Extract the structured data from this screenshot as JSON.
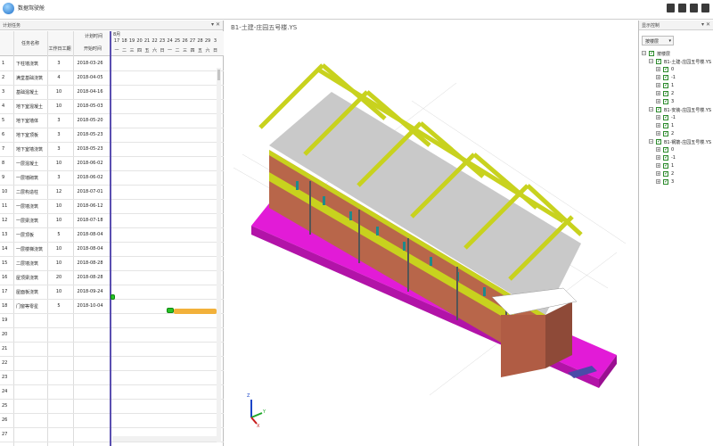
{
  "app": {
    "title": "数据驾驶舱"
  },
  "left_pane": {
    "title": "计划任务",
    "headers": {
      "task_name": "任务名称",
      "plan_time": "计划时间",
      "work_days": "工作日工期",
      "start_time": "开始时间",
      "month": "8月",
      "days": [
        "17",
        "18",
        "19",
        "20",
        "21",
        "22",
        "23",
        "24",
        "25",
        "26",
        "27",
        "28",
        "29",
        "3"
      ],
      "weekdays": [
        "一",
        "二",
        "三",
        "四",
        "五",
        "六",
        "日",
        "一",
        "二",
        "三",
        "四",
        "五",
        "六",
        "日"
      ]
    },
    "rows": [
      {
        "idx": "1",
        "name": "下柱墙浇筑",
        "dur": "3",
        "date": "2018-03-26"
      },
      {
        "idx": "2",
        "name": "满堂基础浇筑",
        "dur": "4",
        "date": "2018-04-05"
      },
      {
        "idx": "3",
        "name": "基础混凝土",
        "dur": "10",
        "date": "2018-04-16"
      },
      {
        "idx": "4",
        "name": "地下室混凝土",
        "dur": "10",
        "date": "2018-05-03"
      },
      {
        "idx": "5",
        "name": "地下室墙体",
        "dur": "3",
        "date": "2018-05-20"
      },
      {
        "idx": "6",
        "name": "地下室顶板",
        "dur": "3",
        "date": "2018-05-23"
      },
      {
        "idx": "7",
        "name": "地下室墙浇筑",
        "dur": "3",
        "date": "2018-05-23"
      },
      {
        "idx": "8",
        "name": "一层混凝土",
        "dur": "10",
        "date": "2018-06-02"
      },
      {
        "idx": "9",
        "name": "一层墙砌筑",
        "dur": "3",
        "date": "2018-06-02"
      },
      {
        "idx": "10",
        "name": "二层构造柱",
        "dur": "12",
        "date": "2018-07-01"
      },
      {
        "idx": "11",
        "name": "一层墙浇筑",
        "dur": "10",
        "date": "2018-06-12"
      },
      {
        "idx": "12",
        "name": "一层梁浇筑",
        "dur": "10",
        "date": "2018-07-18"
      },
      {
        "idx": "13",
        "name": "一层顶板",
        "dur": "5",
        "date": "2018-08-04"
      },
      {
        "idx": "14",
        "name": "一层楼梯浇筑",
        "dur": "10",
        "date": "2018-08-04"
      },
      {
        "idx": "15",
        "name": "二层墙浇筑",
        "dur": "10",
        "date": "2018-08-28"
      },
      {
        "idx": "16",
        "name": "屋顶梁浇筑",
        "dur": "20",
        "date": "2018-08-28"
      },
      {
        "idx": "17",
        "name": "屋面板浇筑",
        "dur": "10",
        "date": "2018-09-24"
      },
      {
        "idx": "18",
        "name": "门窗等零星",
        "dur": "5",
        "date": "2018-10-04"
      },
      {
        "idx": "19",
        "name": "",
        "dur": "",
        "date": ""
      },
      {
        "idx": "20",
        "name": "",
        "dur": "",
        "date": ""
      },
      {
        "idx": "21",
        "name": "",
        "dur": "",
        "date": ""
      },
      {
        "idx": "22",
        "name": "",
        "dur": "",
        "date": ""
      },
      {
        "idx": "23",
        "name": "",
        "dur": "",
        "date": ""
      },
      {
        "idx": "24",
        "name": "",
        "dur": "",
        "date": ""
      },
      {
        "idx": "25",
        "name": "",
        "dur": "",
        "date": ""
      },
      {
        "idx": "26",
        "name": "",
        "dur": "",
        "date": ""
      },
      {
        "idx": "27",
        "name": "",
        "dur": "",
        "date": ""
      }
    ]
  },
  "viewport": {
    "title": "B1-土建-庄园五号楼.YS"
  },
  "right_pane": {
    "title": "显示控制",
    "dropdown": "按楼层",
    "tree": [
      {
        "level": 0,
        "label": "按楼层",
        "exp": "−"
      },
      {
        "level": 1,
        "label": "B1-土建-庄园五号楼.YS",
        "exp": "−"
      },
      {
        "level": 2,
        "label": "0",
        "exp": "+"
      },
      {
        "level": 2,
        "label": "-1",
        "exp": "+"
      },
      {
        "level": 2,
        "label": "1",
        "exp": "+"
      },
      {
        "level": 2,
        "label": "2",
        "exp": "+"
      },
      {
        "level": 2,
        "label": "3",
        "exp": "+"
      },
      {
        "level": 1,
        "label": "B1-安装-庄园五号楼.YS",
        "exp": "−"
      },
      {
        "level": 2,
        "label": "-1",
        "exp": "+"
      },
      {
        "level": 2,
        "label": "1",
        "exp": "+"
      },
      {
        "level": 2,
        "label": "2",
        "exp": "+"
      },
      {
        "level": 1,
        "label": "B1-钢筋-庄园五号楼.YS",
        "exp": "−"
      },
      {
        "level": 2,
        "label": "0",
        "exp": "+"
      },
      {
        "level": 2,
        "label": "-1",
        "exp": "+"
      },
      {
        "level": 2,
        "label": "1",
        "exp": "+"
      },
      {
        "level": 2,
        "label": "2",
        "exp": "+"
      },
      {
        "level": 2,
        "label": "3",
        "exp": "+"
      }
    ]
  },
  "axis": {
    "z": "Z",
    "x": "X",
    "y": "Y"
  },
  "colors": {
    "slab": "#e21bd7",
    "beam": "#c8d21e",
    "wall": "#b8664a",
    "glass": "#1f8a8a"
  }
}
